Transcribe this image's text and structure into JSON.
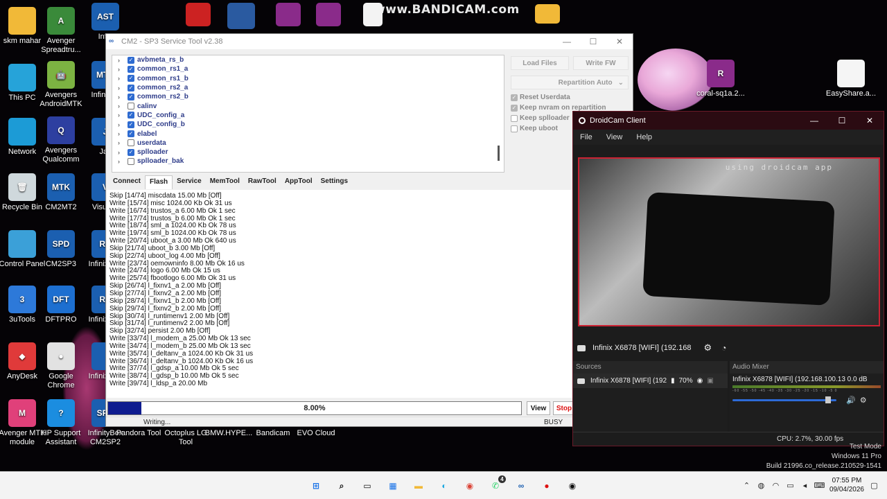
{
  "watermark": "www.BANDICAM.com",
  "desktop": {
    "icons": [
      {
        "label": "skm mahar",
        "icon": "folder-icon",
        "color": "#f1b938",
        "glyph": ""
      },
      {
        "label": "Avenger Spreadtru...",
        "icon": "avenger-icon",
        "color": "#3a8a3a",
        "glyph": "A"
      },
      {
        "label": "Infin",
        "icon": "ast-icon",
        "color": "#1b5fb0",
        "glyph": "AST"
      },
      {
        "label": "This PC",
        "icon": "monitor-icon",
        "color": "#26a3d9",
        "glyph": ""
      },
      {
        "label": "Avengers AndroidMTK",
        "icon": "android-icon",
        "color": "#7cb342",
        "glyph": "🤖"
      },
      {
        "label": "Infin CM",
        "icon": "mtk-icon",
        "color": "#1b5fb0",
        "glyph": "MTK"
      },
      {
        "label": "Network",
        "icon": "network-icon",
        "color": "#1c9bd6",
        "glyph": ""
      },
      {
        "label": "Avengers Qualcomm",
        "icon": "qualcomm-icon",
        "color": "#2d3fa0",
        "glyph": "Q"
      },
      {
        "label": "Jaz",
        "icon": "jaz-icon",
        "color": "#1b5fb0",
        "glyph": "J"
      },
      {
        "label": "Recycle Bin",
        "icon": "recycle-bin-icon",
        "color": "#cfd8dc",
        "glyph": "🗑"
      },
      {
        "label": "CM2MT2",
        "icon": "cm2mt2-icon",
        "color": "#1b5fb0",
        "glyph": "MTK"
      },
      {
        "label": "Visua C",
        "icon": "visual-icon",
        "color": "#1b5fb0",
        "glyph": "V"
      },
      {
        "label": "Control Panel",
        "icon": "control-panel-icon",
        "color": "#3ba0d8",
        "glyph": ""
      },
      {
        "label": "CM2SP3",
        "icon": "cm2sp3-icon",
        "color": "#1b5fb0",
        "glyph": "SPD"
      },
      {
        "label": "Infinix CM",
        "icon": "infinix-icon",
        "color": "#1b5fb0",
        "glyph": "RD"
      },
      {
        "label": "3uTools",
        "icon": "3utools-icon",
        "color": "#2d79d9",
        "glyph": "3"
      },
      {
        "label": "DFTPRO",
        "icon": "dftpro-icon",
        "color": "#1d6fd0",
        "glyph": "DFT"
      },
      {
        "label": "Infinix CM",
        "icon": "infinix-icon",
        "color": "#1b5fb0",
        "glyph": "RK"
      },
      {
        "label": "AnyDesk",
        "icon": "anydesk-icon",
        "color": "#e03a3a",
        "glyph": "◆"
      },
      {
        "label": "Google Chrome",
        "icon": "chrome-icon",
        "color": "#e2e2e2",
        "glyph": "●"
      },
      {
        "label": "Infinix CM",
        "icon": "infinix-icon",
        "color": "#1b5fb0",
        "glyph": ""
      },
      {
        "label": "Avenger MTK module",
        "icon": "avenger-mtk-icon",
        "color": "#e0407a",
        "glyph": "M"
      },
      {
        "label": "HP Support Assistant",
        "icon": "hp-support-icon",
        "color": "#1b8de0",
        "glyph": "?"
      },
      {
        "label": "InfinityBox CM2SP2",
        "icon": "infinitybox-icon",
        "color": "#1b5fb0",
        "glyph": "SPD"
      },
      {
        "label": "Pandora Tool",
        "icon": "pandora-icon",
        "color": "#000",
        "glyph": ""
      },
      {
        "label": "Octoplus LG Tool",
        "icon": "octoplus-icon",
        "color": "#000",
        "glyph": ""
      },
      {
        "label": "BMW.HYPE...",
        "icon": "bmw-icon",
        "color": "#000",
        "glyph": ""
      },
      {
        "label": "Bandicam",
        "icon": "bandicam-icon",
        "color": "#000",
        "glyph": ""
      },
      {
        "label": "EVO Cloud",
        "icon": "evo-icon",
        "color": "#000",
        "glyph": ""
      },
      {
        "label": "coral-sq1a.2...",
        "icon": "winrar-icon",
        "color": "#8a2b8a",
        "glyph": "R"
      },
      {
        "label": "EasyShare.a...",
        "icon": "file-icon",
        "color": "#f5f5f5",
        "glyph": ""
      }
    ]
  },
  "cm2": {
    "title": "CM2 - SP3 Service Tool v2.38",
    "partitions": [
      {
        "name": "avbmeta_rs_b",
        "checked": true
      },
      {
        "name": "common_rs1_a",
        "checked": true
      },
      {
        "name": "common_rs1_b",
        "checked": true
      },
      {
        "name": "common_rs2_a",
        "checked": true
      },
      {
        "name": "common_rs2_b",
        "checked": true
      },
      {
        "name": "calinv",
        "checked": false
      },
      {
        "name": "UDC_config_a",
        "checked": true
      },
      {
        "name": "UDC_config_b",
        "checked": true
      },
      {
        "name": "elabel",
        "checked": true
      },
      {
        "name": "userdata",
        "checked": false
      },
      {
        "name": "splloader",
        "checked": true
      },
      {
        "name": "splloader_bak",
        "checked": false
      }
    ],
    "load_files": "Load Files",
    "write_fw": "Write FW",
    "repartition": "Repartition Auto",
    "options": [
      {
        "label": "Reset Userdata",
        "checked": true
      },
      {
        "label": "Keep nvram on repartition",
        "checked": true
      },
      {
        "label": "Keep splloader",
        "checked": false
      },
      {
        "label": "Keep uboot",
        "checked": false
      }
    ],
    "tabs": [
      "Connect",
      "Flash",
      "Service",
      "MemTool",
      "RawTool",
      "AppTool",
      "Settings"
    ],
    "active_tab": "Flash",
    "log": [
      "Skip [14/74] miscdata 15.00 Mb [Off]",
      "Write [15/74] misc 1024.00 Kb Ok 31 us",
      "Write [16/74] trustos_a 6.00 Mb Ok 1 sec",
      "Write [17/74] trustos_b 6.00 Mb Ok 1 sec",
      "Write [18/74] sml_a 1024.00 Kb Ok 78 us",
      "Write [19/74] sml_b 1024.00 Kb Ok 78 us",
      "Write [20/74] uboot_a 3.00 Mb Ok 640 us",
      "Skip [21/74] uboot_b 3.00 Mb [Off]",
      "Skip [22/74] uboot_log 4.00 Mb [Off]",
      "Write [23/74] oemowninfo 8.00 Mb Ok 16 us",
      "Write [24/74] logo 6.00 Mb Ok 15 us",
      "Write [25/74] fbootlogo 6.00 Mb Ok 31 us",
      "Skip [26/74] l_fixnv1_a 2.00 Mb [Off]",
      "Skip [27/74] l_fixnv2_a 2.00 Mb [Off]",
      "Skip [28/74] l_fixnv1_b 2.00 Mb [Off]",
      "Skip [29/74] l_fixnv2_b 2.00 Mb [Off]",
      "Skip [30/74] l_runtimenv1 2.00 Mb [Off]",
      "Skip [31/74] l_runtimenv2 2.00 Mb [Off]",
      "Skip [32/74] persist 2.00 Mb [Off]",
      "Write [33/74] l_modem_a 25.00 Mb Ok 13 sec",
      "Write [34/74] l_modem_b 25.00 Mb Ok 13 sec",
      "Write [35/74] l_deltanv_a 1024.00 Kb Ok 31 us",
      "Write [36/74] l_deltanv_b 1024.00 Kb Ok 16 us",
      "Write [37/74] l_gdsp_a 10.00 Mb Ok 5 sec",
      "Write [38/74] l_gdsp_b 10.00 Mb Ok 5 sec",
      "Write [39/74] l_ldsp_a 20.00 Mb"
    ],
    "progress_text": "8.00%",
    "progress_value": 0.08,
    "view_label": "View",
    "stop_label": "Stop",
    "status_left": "Writing...",
    "status_right": "BUSY"
  },
  "droidcam": {
    "title": "DroidCam Client",
    "menu": [
      "File",
      "View",
      "Help"
    ],
    "preview_watermark": "using droidcam app",
    "source_name": "Infinix X6878 [WIFI] (192.168",
    "sources_header": "Sources",
    "sources_item": "Infinix X6878 [WIFI] (192",
    "sources_volume": "70%",
    "mixer_header": "Audio Mixer",
    "mixer_name": "Infinix X6878 [WIFI] (192.168.100.13",
    "mixer_db": "0.0 dB",
    "mixer_scale": "-60 -55 -50 -45 -40 -35 -30 -25 -20 -15 -10 -5 0",
    "mixer_level": 0.92,
    "status": "CPU: 2.7%, 30.00 fps",
    "accent": "#cc2233"
  },
  "windows_watermark": {
    "line1": "Test Mode",
    "line2": "Windows 11 Pro",
    "line3": "Build 21996.co_release.210529-1541"
  },
  "taskbar": {
    "apps": [
      {
        "icon": "windows-start-icon",
        "glyph": "⊞",
        "color": "#1a73e8"
      },
      {
        "icon": "search-icon",
        "glyph": "⌕",
        "color": "#111"
      },
      {
        "icon": "task-view-icon",
        "glyph": "▭",
        "color": "#111"
      },
      {
        "icon": "widgets-icon",
        "glyph": "▦",
        "color": "#1a73e8"
      },
      {
        "icon": "file-explorer-icon",
        "glyph": "▬",
        "color": "#f1b938"
      },
      {
        "icon": "edge-icon",
        "glyph": "◐",
        "color": "#1aa7e0"
      },
      {
        "icon": "chrome-icon",
        "glyph": "◉",
        "color": "#db4437"
      },
      {
        "icon": "whatsapp-icon",
        "glyph": "✆",
        "color": "#25d366",
        "badge": "4"
      },
      {
        "icon": "cm2-taskbar-icon",
        "glyph": "∞",
        "color": "#1b5fb0"
      },
      {
        "icon": "bandicam-record-icon",
        "glyph": "●",
        "color": "#d11"
      },
      {
        "icon": "droidcam-taskbar-icon",
        "glyph": "◉",
        "color": "#111"
      }
    ],
    "time": "07:55 PM",
    "date": "09/04/2026"
  }
}
